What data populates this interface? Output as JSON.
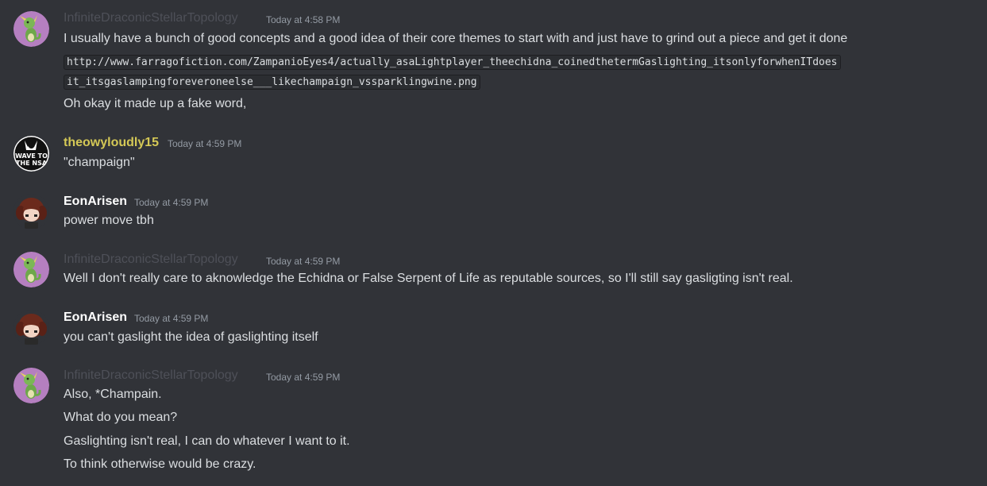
{
  "messages": [
    {
      "author": "InfiniteDraconicStellarTopology",
      "author_color": "#4e5058",
      "timestamp": "Today at 4:58 PM",
      "avatar": "green-dragon-avatar",
      "lines": [
        "I usually have a bunch of good concepts and a good idea of their core themes to start with and just have to grind out a piece and get it done"
      ],
      "code_lines": [
        "http://www.farragofiction.com/ZampanioEyes4/actually_asaLightplayer_theechidna_coinedthetermGaslighting_itsonlyforwhenITdoes",
        "it_itsgaslampingforeveroneelse___likechampaign_vssparklingwine.png"
      ],
      "after_lines": [
        "Oh okay it made up a fake word,"
      ]
    },
    {
      "author": "theowyloudly15",
      "author_color": "#d4c856",
      "timestamp": "Today at 4:59 PM",
      "avatar": "wave-to-the-nsa-avatar",
      "avatar_text": [
        "WAVE TO",
        "THE NSA"
      ],
      "lines": [
        "\"champaign\""
      ]
    },
    {
      "author": "EonArisen",
      "author_color": "#ffffff",
      "timestamp": "Today at 4:59 PM",
      "avatar": "brown-hair-avatar",
      "lines": [
        "power move tbh"
      ]
    },
    {
      "author": "InfiniteDraconicStellarTopology",
      "author_color": "#4e5058",
      "timestamp": "Today at 4:59 PM",
      "avatar": "green-dragon-avatar",
      "lines": [
        "Well I don't really care to aknowledge the Echidna or False Serpent of Life as reputable sources, so I'll still say gasligting isn't real."
      ]
    },
    {
      "author": "EonArisen",
      "author_color": "#ffffff",
      "timestamp": "Today at 4:59 PM",
      "avatar": "brown-hair-avatar",
      "lines": [
        "you can't gaslight the idea of gaslighting itself"
      ]
    },
    {
      "author": "InfiniteDraconicStellarTopology",
      "author_color": "#4e5058",
      "timestamp": "Today at 4:59 PM",
      "avatar": "green-dragon-avatar",
      "lines": [
        "Also, *Champain.",
        "What do you mean?",
        "Gaslighting isn't real, I can do whatever I want to it.",
        "To think otherwise would be crazy."
      ]
    }
  ]
}
